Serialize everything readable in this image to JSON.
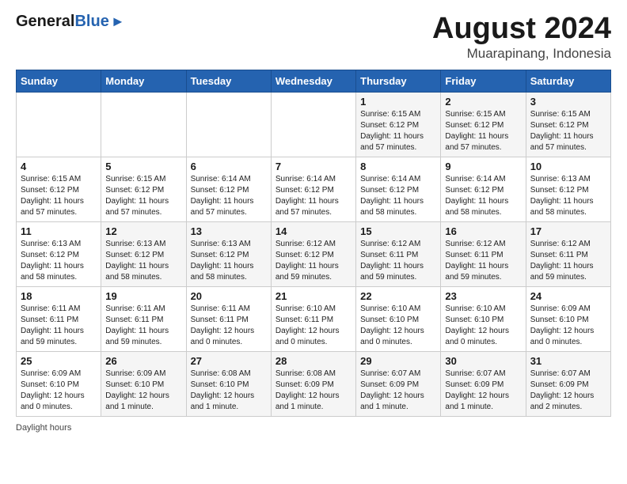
{
  "header": {
    "logo_general": "General",
    "logo_blue": "Blue",
    "title": "August 2024",
    "subtitle": "Muarapinang, Indonesia"
  },
  "calendar": {
    "days_of_week": [
      "Sunday",
      "Monday",
      "Tuesday",
      "Wednesday",
      "Thursday",
      "Friday",
      "Saturday"
    ],
    "weeks": [
      [
        {
          "day": "",
          "info": ""
        },
        {
          "day": "",
          "info": ""
        },
        {
          "day": "",
          "info": ""
        },
        {
          "day": "",
          "info": ""
        },
        {
          "day": "1",
          "info": "Sunrise: 6:15 AM\nSunset: 6:12 PM\nDaylight: 11 hours\nand 57 minutes."
        },
        {
          "day": "2",
          "info": "Sunrise: 6:15 AM\nSunset: 6:12 PM\nDaylight: 11 hours\nand 57 minutes."
        },
        {
          "day": "3",
          "info": "Sunrise: 6:15 AM\nSunset: 6:12 PM\nDaylight: 11 hours\nand 57 minutes."
        }
      ],
      [
        {
          "day": "4",
          "info": "Sunrise: 6:15 AM\nSunset: 6:12 PM\nDaylight: 11 hours\nand 57 minutes."
        },
        {
          "day": "5",
          "info": "Sunrise: 6:15 AM\nSunset: 6:12 PM\nDaylight: 11 hours\nand 57 minutes."
        },
        {
          "day": "6",
          "info": "Sunrise: 6:14 AM\nSunset: 6:12 PM\nDaylight: 11 hours\nand 57 minutes."
        },
        {
          "day": "7",
          "info": "Sunrise: 6:14 AM\nSunset: 6:12 PM\nDaylight: 11 hours\nand 57 minutes."
        },
        {
          "day": "8",
          "info": "Sunrise: 6:14 AM\nSunset: 6:12 PM\nDaylight: 11 hours\nand 58 minutes."
        },
        {
          "day": "9",
          "info": "Sunrise: 6:14 AM\nSunset: 6:12 PM\nDaylight: 11 hours\nand 58 minutes."
        },
        {
          "day": "10",
          "info": "Sunrise: 6:13 AM\nSunset: 6:12 PM\nDaylight: 11 hours\nand 58 minutes."
        }
      ],
      [
        {
          "day": "11",
          "info": "Sunrise: 6:13 AM\nSunset: 6:12 PM\nDaylight: 11 hours\nand 58 minutes."
        },
        {
          "day": "12",
          "info": "Sunrise: 6:13 AM\nSunset: 6:12 PM\nDaylight: 11 hours\nand 58 minutes."
        },
        {
          "day": "13",
          "info": "Sunrise: 6:13 AM\nSunset: 6:12 PM\nDaylight: 11 hours\nand 58 minutes."
        },
        {
          "day": "14",
          "info": "Sunrise: 6:12 AM\nSunset: 6:12 PM\nDaylight: 11 hours\nand 59 minutes."
        },
        {
          "day": "15",
          "info": "Sunrise: 6:12 AM\nSunset: 6:11 PM\nDaylight: 11 hours\nand 59 minutes."
        },
        {
          "day": "16",
          "info": "Sunrise: 6:12 AM\nSunset: 6:11 PM\nDaylight: 11 hours\nand 59 minutes."
        },
        {
          "day": "17",
          "info": "Sunrise: 6:12 AM\nSunset: 6:11 PM\nDaylight: 11 hours\nand 59 minutes."
        }
      ],
      [
        {
          "day": "18",
          "info": "Sunrise: 6:11 AM\nSunset: 6:11 PM\nDaylight: 11 hours\nand 59 minutes."
        },
        {
          "day": "19",
          "info": "Sunrise: 6:11 AM\nSunset: 6:11 PM\nDaylight: 11 hours\nand 59 minutes."
        },
        {
          "day": "20",
          "info": "Sunrise: 6:11 AM\nSunset: 6:11 PM\nDaylight: 12 hours\nand 0 minutes."
        },
        {
          "day": "21",
          "info": "Sunrise: 6:10 AM\nSunset: 6:11 PM\nDaylight: 12 hours\nand 0 minutes."
        },
        {
          "day": "22",
          "info": "Sunrise: 6:10 AM\nSunset: 6:10 PM\nDaylight: 12 hours\nand 0 minutes."
        },
        {
          "day": "23",
          "info": "Sunrise: 6:10 AM\nSunset: 6:10 PM\nDaylight: 12 hours\nand 0 minutes."
        },
        {
          "day": "24",
          "info": "Sunrise: 6:09 AM\nSunset: 6:10 PM\nDaylight: 12 hours\nand 0 minutes."
        }
      ],
      [
        {
          "day": "25",
          "info": "Sunrise: 6:09 AM\nSunset: 6:10 PM\nDaylight: 12 hours\nand 0 minutes."
        },
        {
          "day": "26",
          "info": "Sunrise: 6:09 AM\nSunset: 6:10 PM\nDaylight: 12 hours\nand 1 minute."
        },
        {
          "day": "27",
          "info": "Sunrise: 6:08 AM\nSunset: 6:10 PM\nDaylight: 12 hours\nand 1 minute."
        },
        {
          "day": "28",
          "info": "Sunrise: 6:08 AM\nSunset: 6:09 PM\nDaylight: 12 hours\nand 1 minute."
        },
        {
          "day": "29",
          "info": "Sunrise: 6:07 AM\nSunset: 6:09 PM\nDaylight: 12 hours\nand 1 minute."
        },
        {
          "day": "30",
          "info": "Sunrise: 6:07 AM\nSunset: 6:09 PM\nDaylight: 12 hours\nand 1 minute."
        },
        {
          "day": "31",
          "info": "Sunrise: 6:07 AM\nSunset: 6:09 PM\nDaylight: 12 hours\nand 2 minutes."
        }
      ]
    ]
  },
  "footer": {
    "daylight_label": "Daylight hours"
  }
}
